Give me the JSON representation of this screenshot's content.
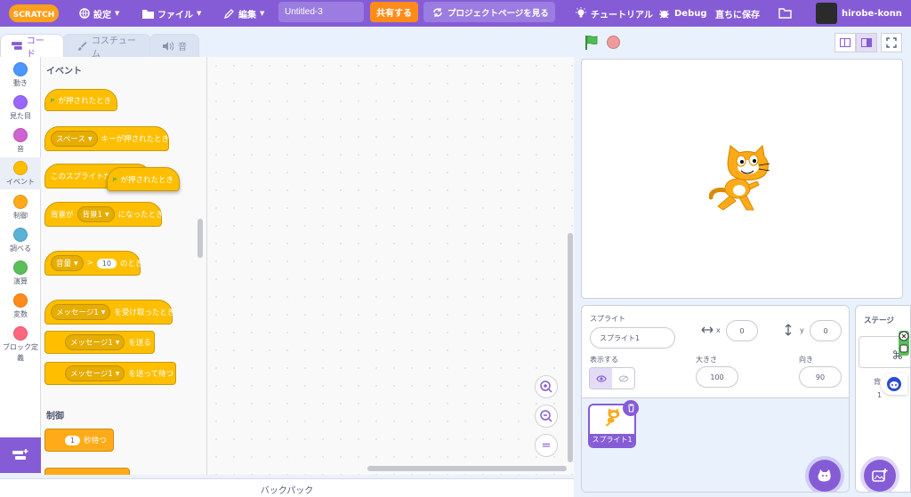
{
  "menubar": {
    "logo_text": "SCRATCH",
    "settings": "設定",
    "file": "ファイル",
    "edit": "編集",
    "project_title": "Untitled-3",
    "share": "共有する",
    "see_project_page": "プロジェクトページを見る",
    "tutorials": "チュートリアル",
    "debug": "Debug",
    "save_now": "直ちに保存",
    "username": "hirobe-konn"
  },
  "tabs": {
    "code": "コード",
    "costumes": "コスチューム",
    "sounds": "音"
  },
  "categories": [
    {
      "label": "動き",
      "color": "#4c97ff"
    },
    {
      "label": "見た目",
      "color": "#9966ff"
    },
    {
      "label": "音",
      "color": "#cf63cf"
    },
    {
      "label": "イベント",
      "color": "#ffbf00"
    },
    {
      "label": "制御",
      "color": "#ffab19"
    },
    {
      "label": "調べる",
      "color": "#5cb1d6"
    },
    {
      "label": "演算",
      "color": "#59c059"
    },
    {
      "label": "変数",
      "color": "#ff8c1a"
    },
    {
      "label": "ブロック定義",
      "color": "#ff6680"
    }
  ],
  "flyout": {
    "events_heading": "イベント",
    "control_heading": "制御",
    "block_flag_clicked": "が押されたとき",
    "block_key_dropdown": "スペース",
    "block_key_text": "キーが押されたとき",
    "block_sprite_clicked": "このスプライトが",
    "block_dragging_text": "が押されたとき",
    "block_backdrop_prefix": "背景が",
    "block_backdrop_dropdown": "背景1",
    "block_backdrop_suffix": "になったとき",
    "block_loudness_dropdown": "音量",
    "block_loudness_op": ">",
    "block_loudness_value": "10",
    "block_loudness_suffix": "のとき",
    "block_receive_dropdown": "メッセージ1",
    "block_receive_suffix": "を受け取ったとき",
    "block_broadcast_dropdown": "メッセージ1",
    "block_broadcast_suffix": "を送る",
    "block_broadcast_wait_dropdown": "メッセージ1",
    "block_broadcast_wait_suffix": "を送って待つ",
    "block_wait_value": "1",
    "block_wait_suffix": "秒待つ"
  },
  "zoom": {
    "zoom_in": "+",
    "zoom_out": "−",
    "reset": "="
  },
  "backpack_label": "バックパック",
  "sprite_info": {
    "heading": "スプライト",
    "name": "スプライト1",
    "x_label": "x",
    "x_value": "0",
    "y_label": "y",
    "y_value": "0",
    "show_label": "表示する",
    "size_label": "大きさ",
    "size_value": "100",
    "direction_label": "向き",
    "direction_value": "90"
  },
  "sprite_list": [
    {
      "name": "スプライト1",
      "selected": true
    }
  ],
  "stage_pane": {
    "heading": "ステージ",
    "backdrops_label_partial": "背",
    "backdrops_count": "1"
  },
  "colors": {
    "menubar": "#855cd6",
    "share": "#ff8c1a",
    "events": "#ffbf00"
  }
}
